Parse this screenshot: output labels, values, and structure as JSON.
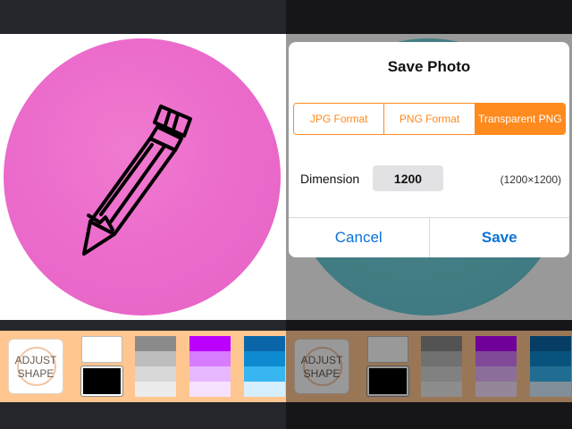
{
  "adjust_shape_label": [
    "ADJUST",
    "SHAPE"
  ],
  "icons": {
    "canvas_icon": "pencil-icon"
  },
  "colors": {
    "canvas_circle_left": "#ec6ccc",
    "canvas_circle_right": "#6fd0dd",
    "toolbar_bg": "#ffc68f",
    "accent": "#ff8a1e",
    "link": "#0a72d8"
  },
  "palette": [
    {
      "name": "white-black",
      "shades": [
        "#ffffff",
        "#000000"
      ]
    },
    {
      "name": "gray",
      "shades": [
        "#8a8a8a",
        "#bdbdbd",
        "#d8d8d8",
        "#ececec"
      ]
    },
    {
      "name": "purple",
      "shades": [
        "#bb00ff",
        "#d77cff",
        "#e8b8ff",
        "#f6e2ff"
      ]
    },
    {
      "name": "blue",
      "shades": [
        "#0a66a8",
        "#0e8ad0",
        "#38b6f2",
        "#d6efff"
      ]
    }
  ],
  "dialog": {
    "title": "Save Photo",
    "format_options": [
      "JPG Format",
      "PNG Format",
      "Transparent PNG"
    ],
    "selected_format": "Transparent PNG",
    "dimension_label": "Dimension",
    "dimension_value": "1200",
    "dimension_size": "(1200×1200)",
    "cancel_label": "Cancel",
    "save_label": "Save"
  }
}
